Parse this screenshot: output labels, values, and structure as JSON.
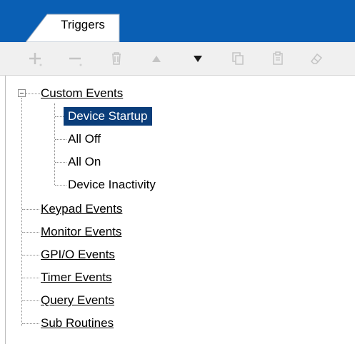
{
  "tab": {
    "label": "Triggers"
  },
  "toolbar": {
    "buttons": [
      {
        "name": "add",
        "icon": "plus-icon"
      },
      {
        "name": "remove",
        "icon": "minus-icon"
      },
      {
        "name": "delete",
        "icon": "trash-icon"
      },
      {
        "name": "move-up",
        "icon": "triangle-up-icon"
      },
      {
        "name": "move-down",
        "icon": "triangle-down-icon"
      },
      {
        "name": "copy",
        "icon": "copy-icon"
      },
      {
        "name": "paste",
        "icon": "paste-icon"
      },
      {
        "name": "edit",
        "icon": "eraser-icon"
      }
    ]
  },
  "colors": {
    "header_bg": "#0a5fb4",
    "selection_bg": "#0a3d7a",
    "toolbar_bg": "#f0f0f0"
  },
  "tree": {
    "root": {
      "label": "Custom Events",
      "expanded": true,
      "children": [
        {
          "label": "Device Startup",
          "selected": true
        },
        {
          "label": "All Off"
        },
        {
          "label": "All On"
        },
        {
          "label": "Device Inactivity"
        }
      ]
    },
    "categories": [
      {
        "label": "Keypad Events"
      },
      {
        "label": "Monitor Events"
      },
      {
        "label": "GPI/O Events"
      },
      {
        "label": "Timer Events"
      },
      {
        "label": "Query Events"
      },
      {
        "label": "Sub Routines"
      }
    ]
  }
}
